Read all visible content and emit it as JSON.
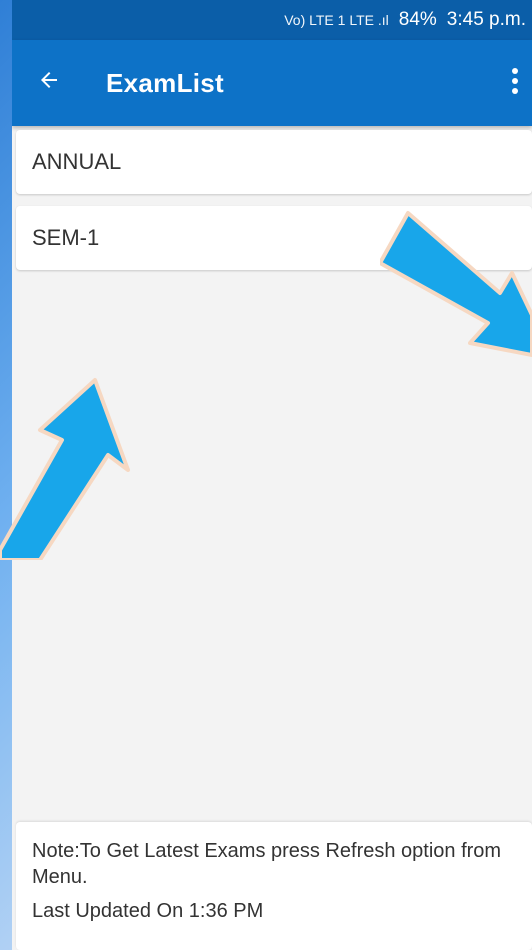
{
  "status_bar": {
    "indicators": "Vo) LTE 1 LTE .ıl",
    "battery": "84%",
    "time": "3:45 p.m."
  },
  "app_bar": {
    "title": "ExamList",
    "back_icon": "arrow-left-icon",
    "menu_icon": "overflow-menu-icon"
  },
  "exams": [
    {
      "label": "ANNUAL"
    },
    {
      "label": "SEM-1"
    }
  ],
  "footer": {
    "note": "Note:To Get Latest Exams press Refresh option from Menu.",
    "last_updated": "Last Updated On 1:36 PM"
  },
  "colors": {
    "status_bar": "#0b5ea8",
    "app_bar": "#0d72c7",
    "arrow_fill": "#18a6ea",
    "arrow_outline": "#f6d8c2"
  }
}
